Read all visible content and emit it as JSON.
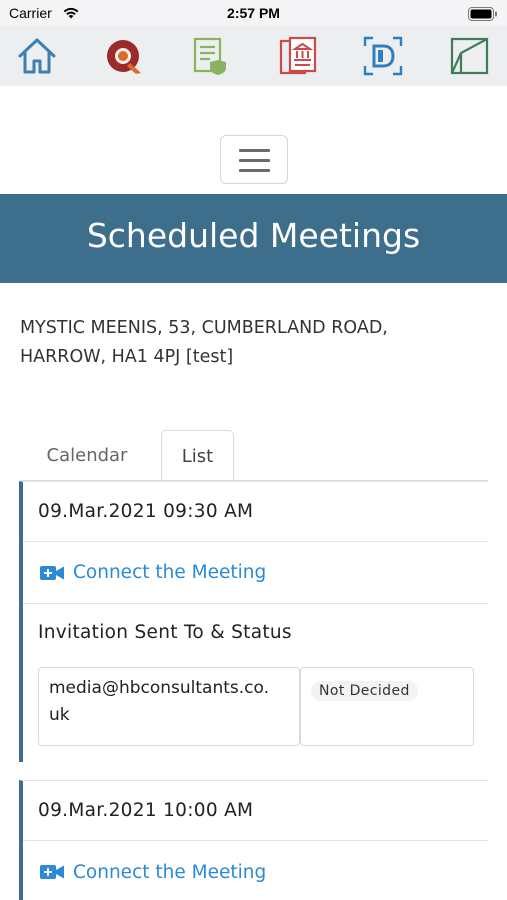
{
  "status_bar": {
    "carrier": "Carrier",
    "time": "2:57 PM"
  },
  "toolbar": {
    "icons": [
      "home-icon",
      "q-logo-icon",
      "document-shield-icon",
      "building-document-icon",
      "d-scan-icon",
      "folder-edit-icon"
    ],
    "colors": {
      "home": "#3c7fb4",
      "q_logo_outer": "#9b2a2a",
      "q_logo_inner": "#e06a2a",
      "doc_shield": "#8ab35f",
      "building_doc": "#cc4a4a",
      "d_scan": "#2f7fc0",
      "folder_edit": "#3f7d56"
    }
  },
  "menu": {
    "hamburger": "menu-icon"
  },
  "header": {
    "title": "Scheduled Meetings",
    "bg_color": "#3d6f8c"
  },
  "property": {
    "address_line1": "MYSTIC MEENIS, 53, CUMBERLAND ROAD,",
    "address_line2": "HARROW, HA1 4PJ [test]"
  },
  "tabs": [
    {
      "label": "Calendar",
      "active": false
    },
    {
      "label": "List",
      "active": true
    }
  ],
  "meetings": [
    {
      "datetime": "09.Mar.2021 09:30 AM",
      "connect_label": "Connect the Meeting",
      "invitation_title": "Invitation Sent To & Status",
      "invitees": [
        {
          "email_line1": "media@hbconsultants.co.",
          "email_line2": "uk",
          "status": "Not Decided"
        }
      ]
    },
    {
      "datetime": "09.Mar.2021 10:00 AM",
      "connect_label": "Connect the Meeting"
    }
  ],
  "link_color": "#2a8ad8"
}
